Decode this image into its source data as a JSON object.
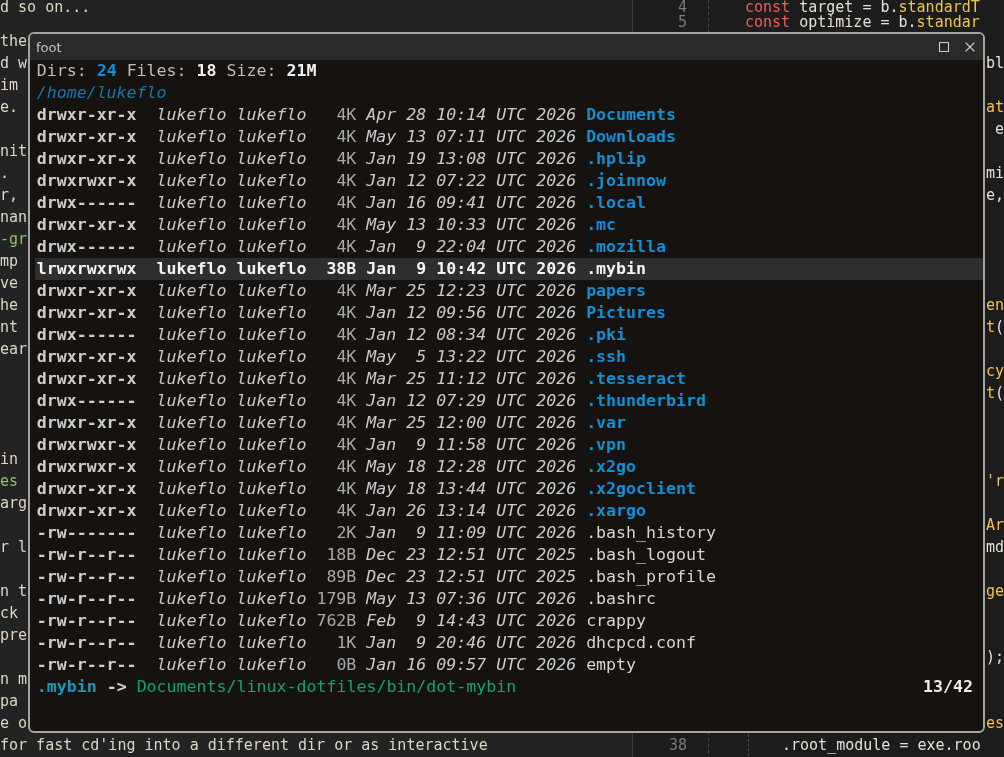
{
  "background": {
    "document": {
      "lines": [
        {
          "text": "d so on...",
          "kind": "text"
        },
        {
          "text": "the",
          "kind": "text"
        },
        {
          "text": "d w",
          "kind": "text"
        },
        {
          "text": "im",
          "kind": "text"
        },
        {
          "text": "e.",
          "kind": "text"
        },
        {
          "text": "nit",
          "kind": "text"
        },
        {
          "text": ".",
          "kind": "text"
        },
        {
          "text": "r,",
          "kind": "text"
        },
        {
          "text": "nan",
          "kind": "text"
        },
        {
          "text": "-gr",
          "kind": "code"
        },
        {
          "text": "mp",
          "kind": "text"
        },
        {
          "text": "ve",
          "kind": "text"
        },
        {
          "text": "he",
          "kind": "text"
        },
        {
          "text": "nt",
          "kind": "text"
        },
        {
          "text": "ear",
          "kind": "text"
        },
        {
          "text": "in",
          "kind": "text"
        },
        {
          "text": "es",
          "kind": "code"
        },
        {
          "text": "arg",
          "kind": "text"
        },
        {
          "text": "r l",
          "kind": "text"
        },
        {
          "text": "n t",
          "kind": "text"
        },
        {
          "text": "ck",
          "kind": "text"
        },
        {
          "text": "pre",
          "kind": "text"
        },
        {
          "text": "n m",
          "kind": "text"
        },
        {
          "text": "pa",
          "kind": "text"
        },
        {
          "text": "e o",
          "kind": "text"
        },
        {
          "text": "for fast cd'ing into a different dir or as interactive",
          "kind": "text"
        }
      ]
    },
    "editor": {
      "lines": [
        {
          "kind": "full",
          "number": "4",
          "indented": false,
          "tokens": [
            {
              "text": "const",
              "kind": "keyword"
            },
            {
              "text": " target = b.",
              "kind": "plain"
            },
            {
              "text": "standardT",
              "kind": "call"
            }
          ]
        },
        {
          "kind": "full",
          "number": "5",
          "indented": false,
          "tokens": [
            {
              "text": "const",
              "kind": "keyword"
            },
            {
              "text": " optimize = b.",
              "kind": "plain"
            },
            {
              "text": "standar",
              "kind": "call"
            }
          ]
        },
        {
          "kind": "tail",
          "tokens": [
            {
              "text": "bl",
              "kind": "plain"
            }
          ]
        },
        {
          "kind": "tail",
          "tokens": [
            {
              "text": "at",
              "kind": "call"
            }
          ]
        },
        {
          "kind": "tail",
          "tokens": [
            {
              "text": "e",
              "kind": "plain"
            }
          ]
        },
        {
          "kind": "tail",
          "tokens": [
            {
              "text": "mi",
              "kind": "plain"
            }
          ]
        },
        {
          "kind": "tail",
          "tokens": [
            {
              "text": "e,",
              "kind": "plain"
            }
          ]
        },
        {
          "kind": "tail",
          "tokens": [
            {
              "text": "en",
              "kind": "call"
            }
          ]
        },
        {
          "kind": "tail",
          "tokens": [
            {
              "text": "t",
              "kind": "call"
            },
            {
              "text": "(",
              "kind": "plain"
            }
          ]
        },
        {
          "kind": "tail",
          "tokens": [
            {
              "text": "cy",
              "kind": "call"
            }
          ]
        },
        {
          "kind": "tail",
          "tokens": [
            {
              "text": "t",
              "kind": "call"
            },
            {
              "text": "(",
              "kind": "plain"
            }
          ]
        },
        {
          "kind": "tail",
          "tokens": [
            {
              "text": "'r",
              "kind": "string"
            }
          ]
        },
        {
          "kind": "tail",
          "tokens": [
            {
              "text": "Ar",
              "kind": "call"
            }
          ]
        },
        {
          "kind": "tail",
          "tokens": [
            {
              "text": "md",
              "kind": "plain"
            }
          ]
        },
        {
          "kind": "tail",
          "tokens": [
            {
              "text": "ge",
              "kind": "call"
            }
          ]
        },
        {
          "kind": "tail",
          "tokens": [
            {
              "text": ");",
              "kind": "plain"
            }
          ]
        },
        {
          "kind": "tail",
          "tokens": [
            {
              "text": "es",
              "kind": "call"
            }
          ]
        },
        {
          "kind": "full",
          "number": "38",
          "indented": true,
          "tokens": [
            {
              "text": ".root_module = exe.roo",
              "kind": "plain"
            }
          ]
        }
      ]
    }
  },
  "window": {
    "title": "foot",
    "summary": [
      {
        "label": "Dirs:",
        "value": "24",
        "kind": "dirs"
      },
      {
        "label": "Files:",
        "value": "18",
        "kind": "files"
      },
      {
        "label": "Size:",
        "value": "21M",
        "kind": "size"
      }
    ],
    "path": "/home/lukeflo",
    "entries": [
      {
        "permissions": "drwxr-xr-x",
        "owner": "lukeflo",
        "group": "lukeflo",
        "size": "4K",
        "date": "Apr 28 10:14 UTC 2026",
        "name": "Documents",
        "kind": "dir",
        "selected": false
      },
      {
        "permissions": "drwxr-xr-x",
        "owner": "lukeflo",
        "group": "lukeflo",
        "size": "4K",
        "date": "May 13 07:11 UTC 2026",
        "name": "Downloads",
        "kind": "dir",
        "selected": false
      },
      {
        "permissions": "drwxr-xr-x",
        "owner": "lukeflo",
        "group": "lukeflo",
        "size": "4K",
        "date": "Jan 19 13:08 UTC 2026",
        "name": ".hplip",
        "kind": "dir",
        "selected": false
      },
      {
        "permissions": "drwxrwxr-x",
        "owner": "lukeflo",
        "group": "lukeflo",
        "size": "4K",
        "date": "Jan 12 07:22 UTC 2026",
        "name": ".joinnow",
        "kind": "dir",
        "selected": false
      },
      {
        "permissions": "drwx------",
        "owner": "lukeflo",
        "group": "lukeflo",
        "size": "4K",
        "date": "Jan 16 09:41 UTC 2026",
        "name": ".local",
        "kind": "dir",
        "selected": false
      },
      {
        "permissions": "drwxr-xr-x",
        "owner": "lukeflo",
        "group": "lukeflo",
        "size": "4K",
        "date": "May 13 10:33 UTC 2026",
        "name": ".mc",
        "kind": "dir",
        "selected": false
      },
      {
        "permissions": "drwx------",
        "owner": "lukeflo",
        "group": "lukeflo",
        "size": "4K",
        "date": "Jan  9 22:04 UTC 2026",
        "name": ".mozilla",
        "kind": "dir",
        "selected": false
      },
      {
        "permissions": "lrwxrwxrwx",
        "owner": "lukeflo",
        "group": "lukeflo",
        "size": "38B",
        "date": "Jan  9 10:42 UTC 2026",
        "name": ".mybin",
        "kind": "link",
        "selected": true
      },
      {
        "permissions": "drwxr-xr-x",
        "owner": "lukeflo",
        "group": "lukeflo",
        "size": "4K",
        "date": "Mar 25 12:23 UTC 2026",
        "name": "papers",
        "kind": "dir",
        "selected": false
      },
      {
        "permissions": "drwxr-xr-x",
        "owner": "lukeflo",
        "group": "lukeflo",
        "size": "4K",
        "date": "Jan 12 09:56 UTC 2026",
        "name": "Pictures",
        "kind": "dir",
        "selected": false
      },
      {
        "permissions": "drwx------",
        "owner": "lukeflo",
        "group": "lukeflo",
        "size": "4K",
        "date": "Jan 12 08:34 UTC 2026",
        "name": ".pki",
        "kind": "dir",
        "selected": false
      },
      {
        "permissions": "drwxr-xr-x",
        "owner": "lukeflo",
        "group": "lukeflo",
        "size": "4K",
        "date": "May  5 13:22 UTC 2026",
        "name": ".ssh",
        "kind": "dir",
        "selected": false
      },
      {
        "permissions": "drwxr-xr-x",
        "owner": "lukeflo",
        "group": "lukeflo",
        "size": "4K",
        "date": "Mar 25 11:12 UTC 2026",
        "name": ".tesseract",
        "kind": "dir",
        "selected": false
      },
      {
        "permissions": "drwx------",
        "owner": "lukeflo",
        "group": "lukeflo",
        "size": "4K",
        "date": "Jan 12 07:29 UTC 2026",
        "name": ".thunderbird",
        "kind": "dir",
        "selected": false
      },
      {
        "permissions": "drwxr-xr-x",
        "owner": "lukeflo",
        "group": "lukeflo",
        "size": "4K",
        "date": "Mar 25 12:00 UTC 2026",
        "name": ".var",
        "kind": "dir",
        "selected": false
      },
      {
        "permissions": "drwxrwxr-x",
        "owner": "lukeflo",
        "group": "lukeflo",
        "size": "4K",
        "date": "Jan  9 11:58 UTC 2026",
        "name": ".vpn",
        "kind": "dir",
        "selected": false
      },
      {
        "permissions": "drwxrwxr-x",
        "owner": "lukeflo",
        "group": "lukeflo",
        "size": "4K",
        "date": "May 18 12:28 UTC 2026",
        "name": ".x2go",
        "kind": "dir",
        "selected": false
      },
      {
        "permissions": "drwxr-xr-x",
        "owner": "lukeflo",
        "group": "lukeflo",
        "size": "4K",
        "date": "May 18 13:44 UTC 2026",
        "name": ".x2goclient",
        "kind": "dir",
        "selected": false
      },
      {
        "permissions": "drwxr-xr-x",
        "owner": "lukeflo",
        "group": "lukeflo",
        "size": "4K",
        "date": "Jan 26 13:14 UTC 2026",
        "name": ".xargo",
        "kind": "dir",
        "selected": false
      },
      {
        "permissions": "-rw-------",
        "owner": "lukeflo",
        "group": "lukeflo",
        "size": "2K",
        "date": "Jan  9 11:09 UTC 2026",
        "name": ".bash_history",
        "kind": "file",
        "selected": false
      },
      {
        "permissions": "-rw-r--r--",
        "owner": "lukeflo",
        "group": "lukeflo",
        "size": "18B",
        "date": "Dec 23 12:51 UTC 2025",
        "name": ".bash_logout",
        "kind": "file",
        "selected": false
      },
      {
        "permissions": "-rw-r--r--",
        "owner": "lukeflo",
        "group": "lukeflo",
        "size": "89B",
        "date": "Dec 23 12:51 UTC 2025",
        "name": ".bash_profile",
        "kind": "file",
        "selected": false
      },
      {
        "permissions": "-rw-r--r--",
        "owner": "lukeflo",
        "group": "lukeflo",
        "size": "179B",
        "date": "May 13 07:36 UTC 2026",
        "name": ".bashrc",
        "kind": "file",
        "selected": false
      },
      {
        "permissions": "-rw-r--r--",
        "owner": "lukeflo",
        "group": "lukeflo",
        "size": "762B",
        "date": "Feb  9 14:43 UTC 2026",
        "name": "crappy",
        "kind": "file",
        "selected": false
      },
      {
        "permissions": "-rw-r--r--",
        "owner": "lukeflo",
        "group": "lukeflo",
        "size": "1K",
        "date": "Jan  9 20:46 UTC 2026",
        "name": "dhcpcd.conf",
        "kind": "file",
        "selected": false
      },
      {
        "permissions": "-rw-r--r--",
        "owner": "lukeflo",
        "group": "lukeflo",
        "size": "0B",
        "date": "Jan 16 09:57 UTC 2026",
        "name": "empty",
        "kind": "file",
        "selected": false
      }
    ],
    "status": {
      "name": ".mybin",
      "arrow": "->",
      "target": "Documents/linux-dotfiles/bin/dot-mybin",
      "position": "13/42"
    }
  }
}
